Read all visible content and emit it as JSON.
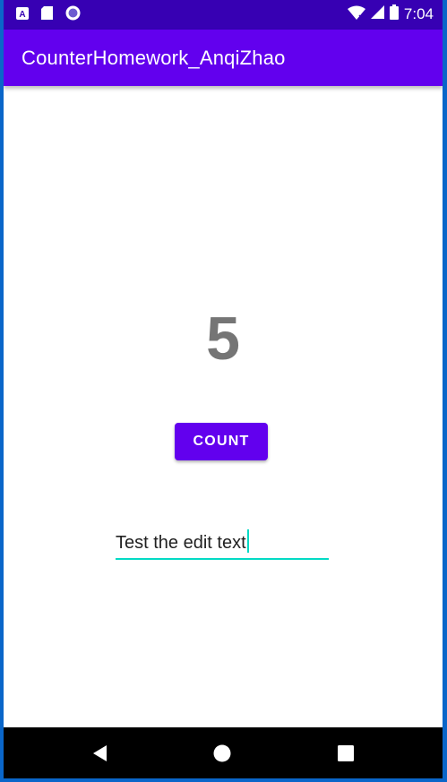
{
  "status_bar": {
    "time": "7:04",
    "left_icons": [
      "a-box-icon",
      "sd-card-icon",
      "record-circle-icon"
    ],
    "right_icons": [
      "wifi-icon",
      "signal-icon",
      "battery-icon"
    ]
  },
  "app_bar": {
    "title": "CounterHomework_AnqiZhao"
  },
  "main": {
    "count_value": "5",
    "count_button_label": "COUNT",
    "edit_text_value": "Test the edit text"
  },
  "navigation_bar": {
    "buttons": [
      "back-icon",
      "home-icon",
      "recents-icon"
    ]
  },
  "colors": {
    "primary": "#6200ee",
    "primary_dark": "#3700b3",
    "accent": "#03dac5",
    "count_text": "#757575"
  }
}
